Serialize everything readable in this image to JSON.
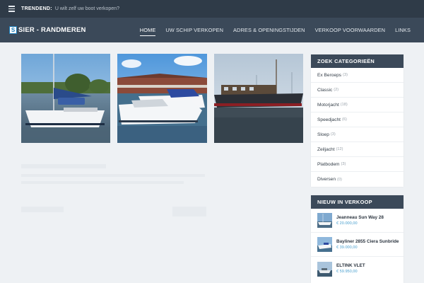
{
  "topbar": {
    "trending_label": "TRENDEND:",
    "trending_text": "U wilt zelf uw boot verkopen?"
  },
  "header": {
    "logo_letter": "S",
    "logo_text": "SIER - RANDMEREN",
    "nav": [
      {
        "label": "HOME",
        "active": true
      },
      {
        "label": "UW SCHIP VERKOPEN"
      },
      {
        "label": "ADRES & OPENINGSTIJDEN"
      },
      {
        "label": "VERKOOP VOORWAARDEN"
      },
      {
        "label": "LINKS"
      }
    ]
  },
  "categories": {
    "title": "ZOEK CATEGORIEËN",
    "items": [
      {
        "name": "Ex Beroeps",
        "count": "(3)"
      },
      {
        "name": "Classic",
        "count": "(2)"
      },
      {
        "name": "Motorjacht",
        "count": "(18)"
      },
      {
        "name": "Speedjacht",
        "count": "(6)"
      },
      {
        "name": "Sloep",
        "count": "(3)"
      },
      {
        "name": "Zeiljacht",
        "count": "(12)"
      },
      {
        "name": "Platbodem",
        "count": "(3)"
      },
      {
        "name": "Diversen",
        "count": "(0)"
      }
    ]
  },
  "new_for_sale": {
    "title": "NIEUW IN VERKOOP",
    "items": [
      {
        "title": "Jeanneau Sun Way 28",
        "price": "€ 20.000,00"
      },
      {
        "title": "Bayliner 2855 Ciera Sunbride",
        "price": "€ 39.000,00"
      },
      {
        "title": "ELTINK VLET",
        "price": "€ 59.950,00"
      }
    ]
  },
  "colors": {
    "nav_bg": "#3b4959",
    "topbar_bg": "#2f3b48",
    "price": "#4aa0cf",
    "page_bg": "#eef1f4"
  }
}
